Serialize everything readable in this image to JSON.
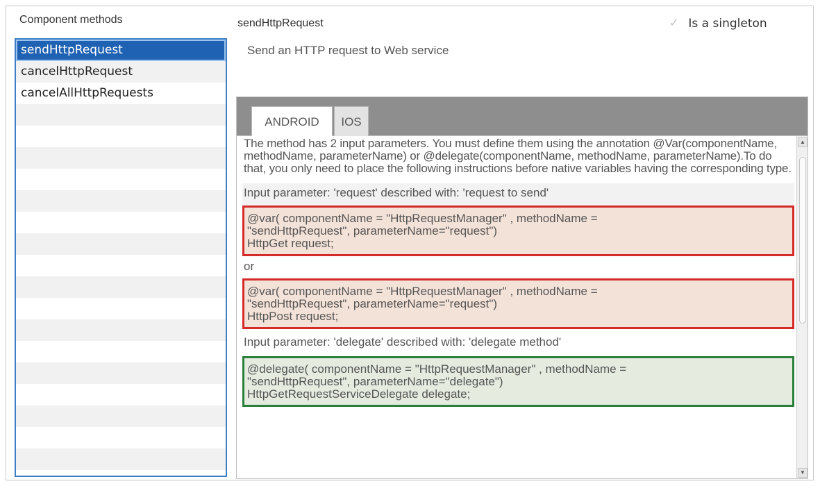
{
  "left_panel": {
    "title": "Component methods",
    "methods": [
      "sendHttpRequest",
      "cancelHttpRequest",
      "cancelAllHttpRequests"
    ],
    "selected": "sendHttpRequest"
  },
  "header": {
    "method_name": "sendHttpRequest",
    "singleton_label": "Is a singleton",
    "singleton_checked": true,
    "description": "Send an HTTP request to Web service"
  },
  "tabs": [
    {
      "label": "ANDROID",
      "active": true
    },
    {
      "label": "IOS",
      "active": false
    }
  ],
  "content": {
    "intro": "The method has 2 input parameters. You must define them using the annotation @Var(componentName, methodName, parameterName) or @delegate(componentName, methodName, parameterName).To do that, you only need to place the following instructions before native variables having the corresponding type.",
    "param1": "Input parameter: 'request' described with: 'request to send'",
    "code1": [
      "@var( componentName = \"HttpRequestManager\" , methodName =",
      "\"sendHttpRequest\", parameterName=\"request\")",
      "HttpGet request;"
    ],
    "or_text": "or",
    "code2": [
      "@var( componentName = \"HttpRequestManager\" , methodName =",
      "\"sendHttpRequest\", parameterName=\"request\")",
      "HttpPost request;"
    ],
    "param2": "Input parameter: 'delegate' described with: 'delegate method'",
    "code3": [
      "@delegate( componentName = \"HttpRequestManager\" , methodName =",
      "\"sendHttpRequest\", parameterName=\"delegate\")",
      "HttpGetRequestServiceDelegate delegate;"
    ]
  },
  "icons": {
    "checkbox": "check-icon",
    "scroll_up": "arrow-up-icon",
    "scroll_down": "arrow-down-icon"
  },
  "colors": {
    "selection": "#1f62b3",
    "list_border": "#3d7fc4",
    "red_box": "#d42a2a",
    "green_box": "#2a7f3a"
  }
}
